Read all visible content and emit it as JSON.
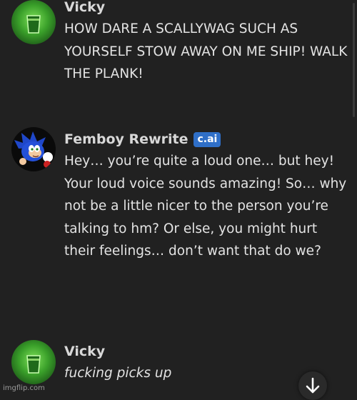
{
  "messages": [
    {
      "author": "Vicky",
      "avatar": "green-glass-icon",
      "text": "HOW DARE A SCALLYWAG SUCH AS YOURSELF STOW AWAY ON ME SHIP! WALK THE PLANK!"
    },
    {
      "author": "Femboy Rewrite",
      "badge": "c.ai",
      "avatar": "hedgehog-character-icon",
      "text": "Hey… you’re quite a loud one… but hey! Your loud voice sounds amazing! So… why not be a little nicer to the person you’re talking to hm? Or else, you might hurt their feelings… don’t want that do we?"
    },
    {
      "author": "Vicky",
      "avatar": "green-glass-icon",
      "text": "fucking picks up"
    }
  ],
  "scroll_button_icon": "arrow-down-icon",
  "watermark": "imgflip.com",
  "colors": {
    "background": "#212121",
    "badge": "#2f6fc8",
    "text": "#e3e3e3"
  }
}
